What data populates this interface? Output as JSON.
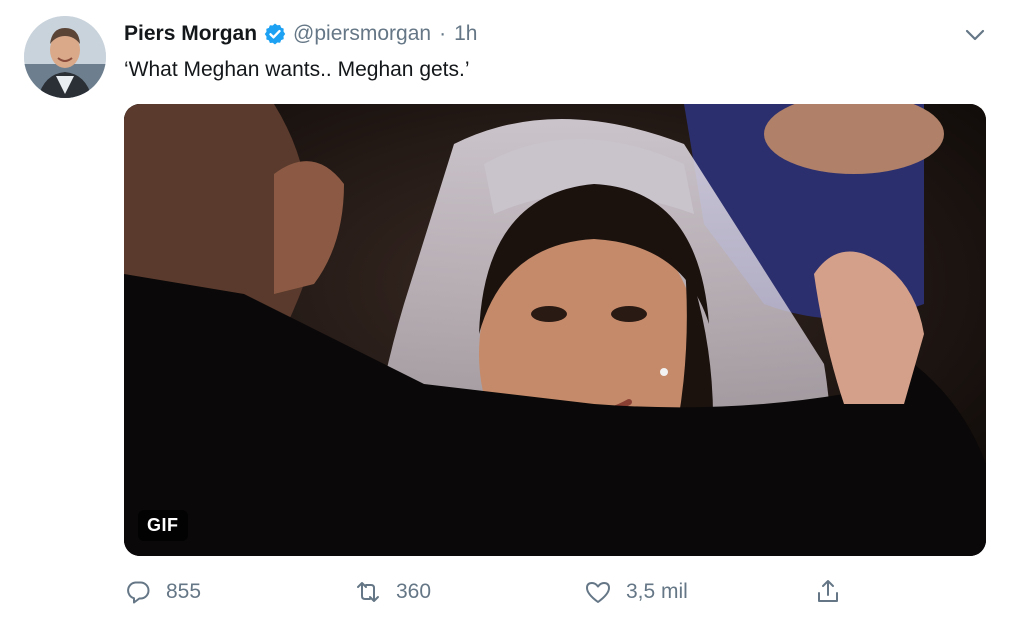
{
  "tweet": {
    "author_name": "Piers Morgan",
    "handle": "@piersmorgan",
    "separator": "·",
    "time": "1h",
    "text": "‘What Meghan wants.. Meghan gets.’",
    "media_badge": "GIF",
    "verified": true
  },
  "actions": {
    "replies": "855",
    "retweets": "360",
    "likes": "3,5 mil"
  },
  "icons": {
    "verified": "verified-badge-icon",
    "menu": "chevron-down-icon",
    "reply": "speech-bubble-icon",
    "retweet": "retweet-arrows-icon",
    "like": "heart-icon",
    "share": "upload-arrow-icon"
  },
  "colors": {
    "name": "#14171a",
    "secondary": "#657786",
    "verified_blue": "#1da1f2",
    "background": "#ffffff"
  }
}
